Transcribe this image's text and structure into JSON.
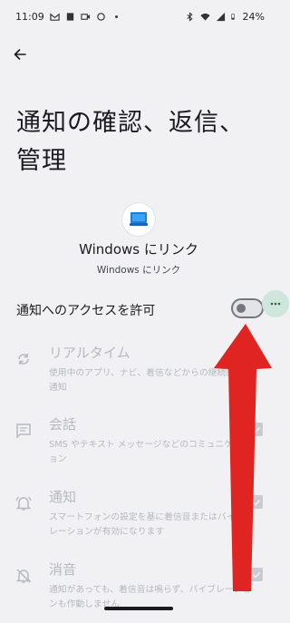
{
  "status_bar": {
    "time": "11:09",
    "battery": "24%",
    "icons_left": [
      "gmail-icon",
      "sim-icon",
      "video-icon",
      "circle-icon",
      "dot-icon"
    ],
    "icons_right": [
      "bluetooth-icon",
      "wifi-icon",
      "signal-icon",
      "battery-icon"
    ]
  },
  "header": {
    "title": "通知の確認、返信、管理"
  },
  "app": {
    "name": "Windows にリンク",
    "subtitle": "Windows にリンク"
  },
  "access_toggle": {
    "label": "通知へのアクセスを許可",
    "enabled": false
  },
  "options": [
    {
      "icon": "sync-icon",
      "title": "リアルタイム",
      "desc": "使用中のアプリ、ナビ、着信などからの継続的な通知",
      "checked": true
    },
    {
      "icon": "chat-icon",
      "title": "会話",
      "desc": "SMS やテキスト メッセージなどのコミュニケーション",
      "checked": true
    },
    {
      "icon": "bell-icon",
      "title": "通知",
      "desc": "スマートフォンの設定を基に着信音またはバイブレーションが有効になります",
      "checked": true
    },
    {
      "icon": "bell-off-icon",
      "title": "消音",
      "desc": "通知があっても、着信音は鳴らず、バイブレーションも作動しません",
      "checked": true
    }
  ],
  "colors": {
    "background": "#f1f1f3",
    "arrow": "#e02422",
    "disabled_text": "#b7b9be"
  }
}
